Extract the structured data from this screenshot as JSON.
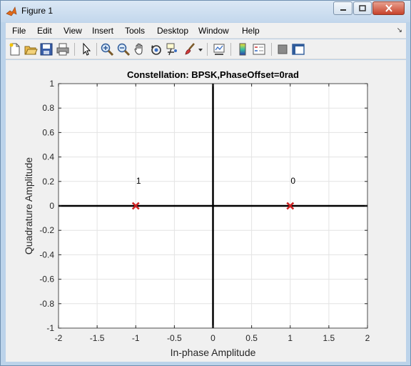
{
  "window": {
    "title": "Figure 1"
  },
  "menubar": {
    "items": [
      "File",
      "Edit",
      "View",
      "Insert",
      "Tools",
      "Desktop",
      "Window",
      "Help"
    ],
    "overflow_arrow": "↘"
  },
  "toolbar": {
    "icons": [
      "new-figure-icon",
      "open-file-icon",
      "save-icon",
      "print-icon",
      "pointer-icon",
      "zoom-in-icon",
      "zoom-out-icon",
      "pan-hand-icon",
      "rotate-3d-icon",
      "data-cursor-icon",
      "brush-icon",
      "brush-dropdown-icon",
      "link-plot-icon",
      "colorbar-icon",
      "legend-icon",
      "hide-plot-tools-icon",
      "show-plot-tools-icon"
    ]
  },
  "chart_data": {
    "type": "scatter",
    "title": "Constellation: BPSK,PhaseOffset=0rad",
    "xlabel": "In-phase Amplitude",
    "ylabel": "Quadrature Amplitude",
    "xlim": [
      -2,
      2
    ],
    "ylim": [
      -1,
      1
    ],
    "xticks": [
      "-2",
      "-1.5",
      "-1",
      "-0.5",
      "0",
      "0.5",
      "1",
      "1.5",
      "2"
    ],
    "yticks": [
      "-1",
      "-0.8",
      "-0.6",
      "-0.4",
      "-0.2",
      "0",
      "0.2",
      "0.4",
      "0.6",
      "0.8",
      "1"
    ],
    "grid": true,
    "marker": "x",
    "marker_color": "#cc2222",
    "points": [
      {
        "x": -1,
        "y": 0,
        "label": "1"
      },
      {
        "x": 1,
        "y": 0,
        "label": "0"
      }
    ]
  }
}
